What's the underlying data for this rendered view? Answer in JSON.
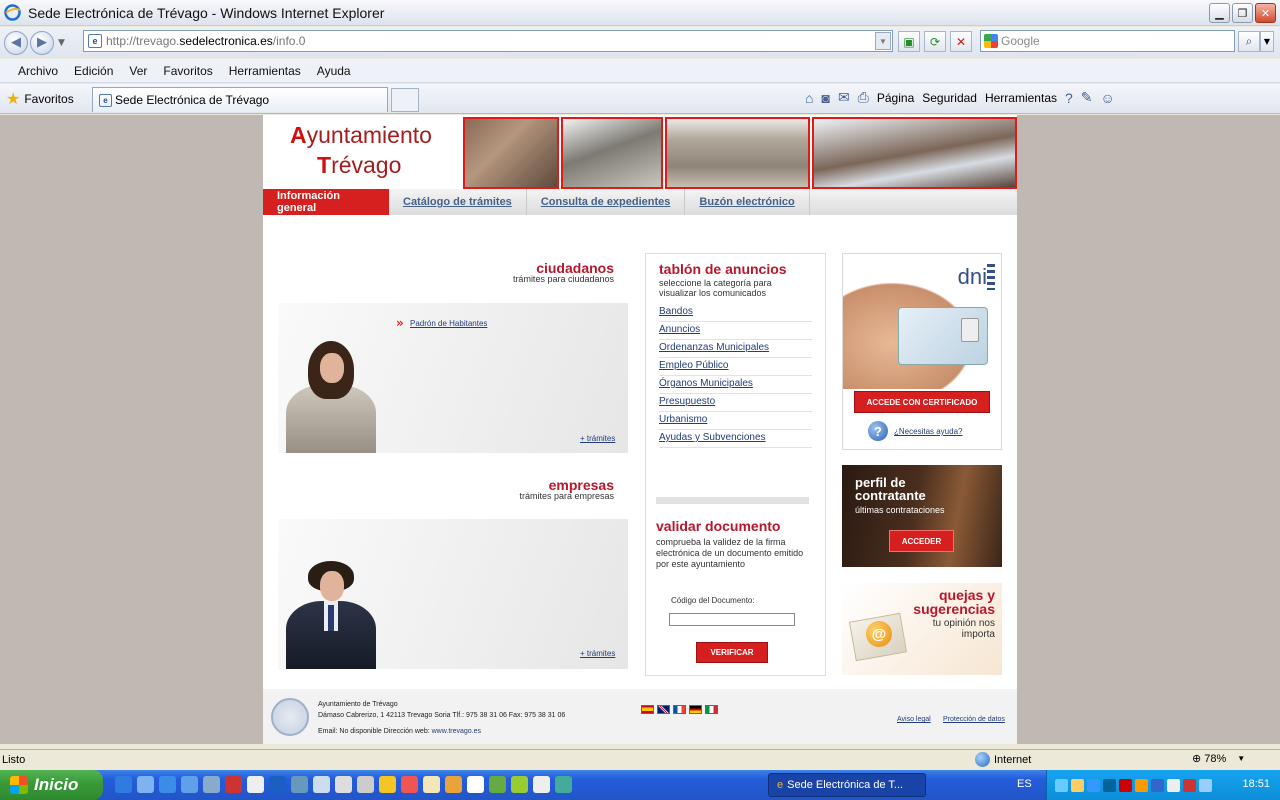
{
  "window": {
    "title": "Sede Electrónica de Trévago - Windows Internet Explorer"
  },
  "address": {
    "url_prefix": "http://trevago.",
    "url_domain": "sedelectronica.es",
    "url_path": "/info.0",
    "search_placeholder": "Google"
  },
  "menu": [
    "Archivo",
    "Edición",
    "Ver",
    "Favoritos",
    "Herramientas",
    "Ayuda"
  ],
  "favorites": {
    "label": "Favoritos",
    "tab_title": "Sede Electrónica de Trévago"
  },
  "commandbar": {
    "page": "Página",
    "security": "Seguridad",
    "tools": "Herramientas"
  },
  "site": {
    "logo_line1_cap": "A",
    "logo_line1_rest": "yuntamiento",
    "logo_line2_cap": "T",
    "logo_line2_rest": "révago",
    "nav": {
      "active": "Información general",
      "items": [
        "Catálogo de trámites",
        "Consulta de expedientes",
        "Buzón electrónico"
      ]
    },
    "ciudadanos": {
      "title": "ciudadanos",
      "subtitle": "trámites para ciudadanos",
      "link": "Padrón de Habitantes",
      "more": "+ trámites"
    },
    "empresas": {
      "title": "empresas",
      "subtitle": "trámites para empresas",
      "more": "+ trámites"
    },
    "tablon": {
      "title": "tablón de anuncios",
      "subtitle": "seleccione la categoría para visualizar los comunicados",
      "items": [
        "Bandos",
        "Anuncios",
        "Ordenanzas Municipales",
        "Empleo Público",
        "Órganos Municipales",
        "Presupuesto",
        "Urbanismo",
        "Ayudas y Subvenciones"
      ]
    },
    "validar": {
      "title": "validar documento",
      "desc": "comprueba la validez de la firma electrónica de un documento emitido por este ayuntamiento",
      "code_label": "Código del Documento:",
      "button": "VERIFICAR"
    },
    "dni": {
      "logo": "dni",
      "button": "ACCEDE CON CERTIFICADO",
      "help": "¿Necesitas ayuda?"
    },
    "perfil": {
      "title": "perfil de contratante",
      "subtitle": "últimas contrataciones",
      "button": "ACCEDER"
    },
    "quejas": {
      "title": "quejas y sugerencias",
      "subtitle": "tu opinión nos importa"
    },
    "footer": {
      "line1": "Ayuntamiento de Trévago",
      "line2": "Dámaso Cabrerizo, 1 42113 Trevago Soria Tlf.: 975 38 31 06 Fax: 975 38 31 06",
      "line3_pre": "Email: No disponible Dirección web: ",
      "web": "www.trevago.es",
      "legal": "Aviso legal",
      "privacy": "Protección de datos"
    }
  },
  "status": {
    "text": "Listo",
    "zone": "Internet",
    "zoom": "78%"
  },
  "taskbar": {
    "start": "Inicio",
    "task": "Sede Electrónica de T...",
    "lang": "ES",
    "clock": "18:51"
  }
}
